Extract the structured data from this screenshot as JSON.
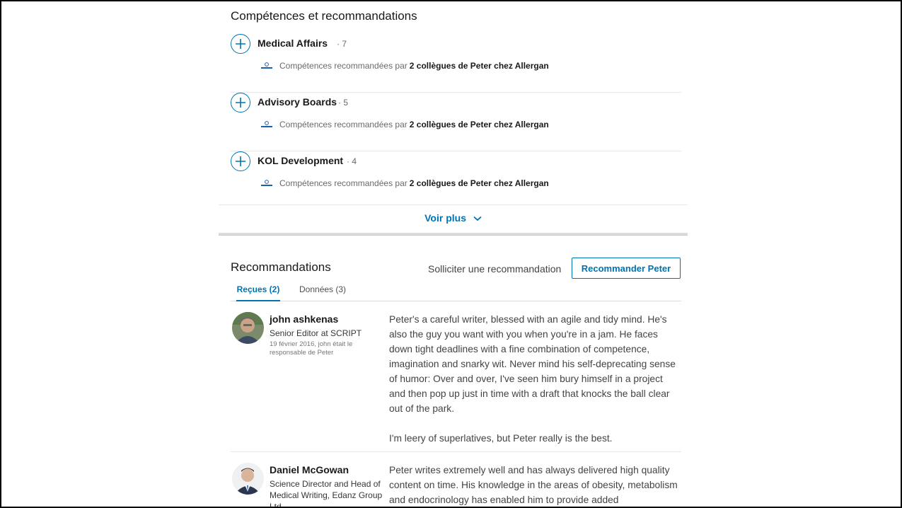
{
  "skills_section": {
    "title": "Compétences et recommandations",
    "skills": [
      {
        "name": "Medical Affairs",
        "count": "· 7",
        "endorse_prefix": "Compétences recommandées par",
        "endorse_bold": "2 collègues de Peter chez Allergan"
      },
      {
        "name": "Advisory Boards",
        "count": "· 5",
        "endorse_prefix": "Compétences recommandées par",
        "endorse_bold": "2 collègues de Peter chez Allergan"
      },
      {
        "name": "KOL Development",
        "count": "· 4",
        "endorse_prefix": "Compétences recommandées par",
        "endorse_bold": "2 collègues de Peter chez Allergan"
      }
    ],
    "see_more": "Voir plus"
  },
  "recommendations": {
    "title": "Recommandations",
    "ask_label": "Solliciter une recommandation",
    "recommend_button": "Recommander Peter",
    "tabs": [
      {
        "label": "Reçues (2)",
        "active": true
      },
      {
        "label": "Données (3)",
        "active": false
      }
    ],
    "items": [
      {
        "name": "john ashkenas",
        "title": "Senior Editor at SCRIPT",
        "meta": "19 février 2016, john était le responsable de Peter",
        "text": [
          "Peter's a careful writer, blessed with an agile and tidy mind. He's also the guy you want with you when you're in a jam. He faces down tight deadlines with a fine combination of competence, imagination and snarky wit. Never mind his self-deprecating sense of humor: Over and over, I've seen him bury himself in a project and then pop up just in time with a draft that knocks the ball clear out of the park.",
          "I'm leery of superlatives, but Peter really is the best."
        ]
      },
      {
        "name": "Daniel McGowan",
        "title": "Science Director and Head of Medical Writing, Edanz Group Ltd",
        "meta": "",
        "text": [
          "Peter writes extremely well and has always delivered high quality content on time. His knowledge in the areas of obesity, metabolism and endocrinology has enabled him to provide added"
        ]
      }
    ]
  },
  "colors": {
    "accent": "#0073b1",
    "divider": "#e6e9ec"
  }
}
